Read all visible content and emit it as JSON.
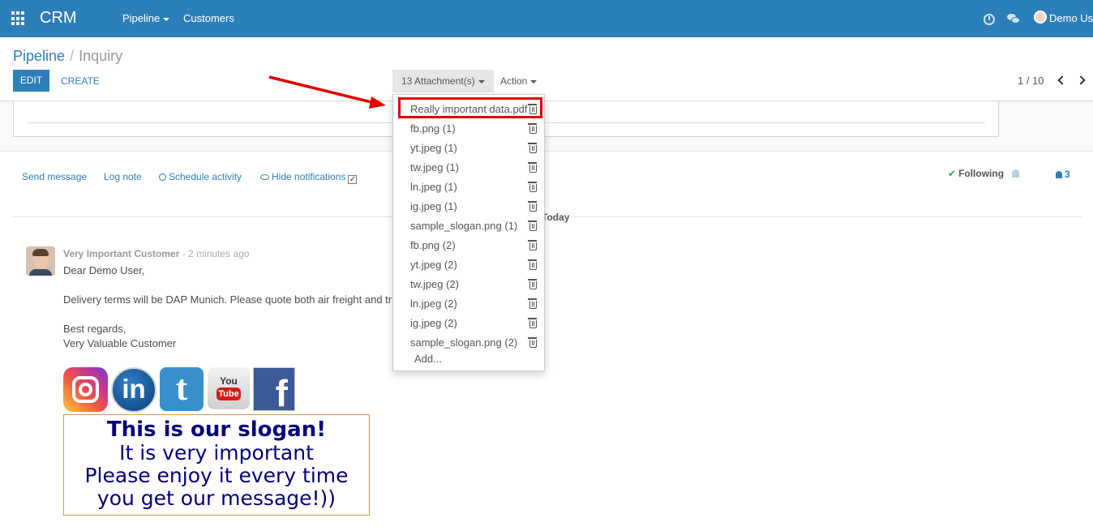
{
  "navbar": {
    "brand": "CRM",
    "menu": [
      "Pipeline",
      "Customers"
    ],
    "user_name": "Demo User",
    "background_color": "#2c7fb8"
  },
  "breadcrumb": {
    "parent": "Pipeline",
    "separator": "/",
    "current": "Inquiry"
  },
  "toolbar": {
    "edit_label": "EDIT",
    "create_label": "CREATE",
    "attachments_label": "13 Attachment(s)",
    "action_label": "Action",
    "pager": "1 / 10"
  },
  "attachments_dropdown": {
    "items": [
      "Really important data.pdf",
      "fb.png (1)",
      "yt.jpeg (1)",
      "tw.jpeg (1)",
      "ln.jpeg (1)",
      "ig.jpeg (1)",
      "sample_slogan.png (1)",
      "fb.png (2)",
      "yt.jpeg (2)",
      "tw.jpeg (2)",
      "ln.jpeg (2)",
      "ig.jpeg (2)",
      "sample_slogan.png (2)"
    ],
    "add_label": "Add...",
    "highlighted_item": "Really important data.pdf",
    "highlight_color": "#e00000"
  },
  "chatter": {
    "send_message": "Send message",
    "log_note": "Log note",
    "schedule_activity": "Schedule activity",
    "hide_notifications": "Hide notifications",
    "following": "Following",
    "followers_count": "3",
    "date_separator": "Today"
  },
  "message": {
    "author": "Very Important Customer",
    "time": "- 2 minutes ago",
    "lines": [
      "Dear Demo User,",
      "Delivery terms will be DAP Munich. Please quote both air freight and truck.",
      "Best regards,",
      "Very Valuable Customer"
    ],
    "social_icons": [
      "instagram-icon",
      "linkedin-icon",
      "twitter-icon",
      "youtube-icon",
      "facebook-icon"
    ],
    "slogan": {
      "title": "This is our slogan!",
      "lines": [
        "It is very important",
        "Please enjoy it every time",
        "you get our message!))"
      ]
    }
  }
}
